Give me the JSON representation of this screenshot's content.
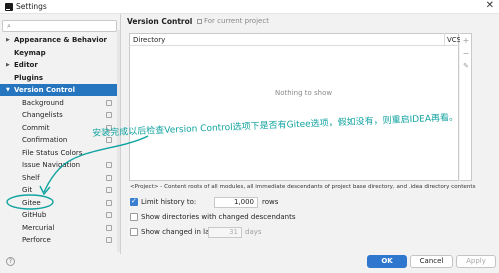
{
  "window": {
    "title": "Settings",
    "close_glyph": "✕",
    "app_icon": "intellij-app-icon"
  },
  "search": {
    "value": "",
    "icon": "search-icon"
  },
  "tree": [
    {
      "label": "Appearance & Behavior",
      "bold": true,
      "arrow": "▶"
    },
    {
      "label": "Keymap",
      "bold": true
    },
    {
      "label": "Editor",
      "bold": true,
      "arrow": "▶"
    },
    {
      "label": "Plugins",
      "bold": true
    },
    {
      "label": "Version Control",
      "bold": true,
      "arrow": "▼",
      "selected": true
    },
    {
      "label": "Background",
      "project_icon": true
    },
    {
      "label": "Changelists",
      "project_icon": true
    },
    {
      "label": "Commit",
      "project_icon": true
    },
    {
      "label": "Confirmation",
      "project_icon": true
    },
    {
      "label": "File Status Colors"
    },
    {
      "label": "Issue Navigation",
      "project_icon": true
    },
    {
      "label": "Shelf",
      "project_icon": true
    },
    {
      "label": "Git",
      "project_icon": true
    },
    {
      "label": "Gitee",
      "project_icon": true
    },
    {
      "label": "GitHub",
      "project_icon": true
    },
    {
      "label": "Mercurial",
      "project_icon": true
    },
    {
      "label": "Perforce",
      "project_icon": true
    }
  ],
  "panel": {
    "title": "Version Control",
    "scope": "For current project",
    "scope_icon": "project-scope-icon",
    "table": {
      "col_directory": "Directory",
      "col_vcs": "VCS",
      "empty": "Nothing to show"
    },
    "tools": [
      "+",
      "−",
      "✎"
    ],
    "note": "<Project> - Content roots of all modules, all immediate descendants of project base directory, and .idea directory contents",
    "limit_history": {
      "label": "Limit history to:",
      "checked": true,
      "value": "1,000",
      "unit": "rows"
    },
    "show_dirs": {
      "label": "Show directories with changed descendants",
      "checked": false
    },
    "show_changed": {
      "label": "Show changed in last",
      "checked": false,
      "value": "31",
      "unit": "days"
    }
  },
  "buttons": {
    "ok": "OK",
    "cancel": "Cancel",
    "apply": "Apply",
    "help": "?"
  },
  "annotation": {
    "text": "安装完成以后检查Version Control选项下是否有Gitee选项，假如没有，则重启IDEA再看。",
    "color": "#11a3a0"
  },
  "colors": {
    "accent": "#2675bf",
    "ok_button": "#2f76cf",
    "annotation": "#11a3a0"
  }
}
